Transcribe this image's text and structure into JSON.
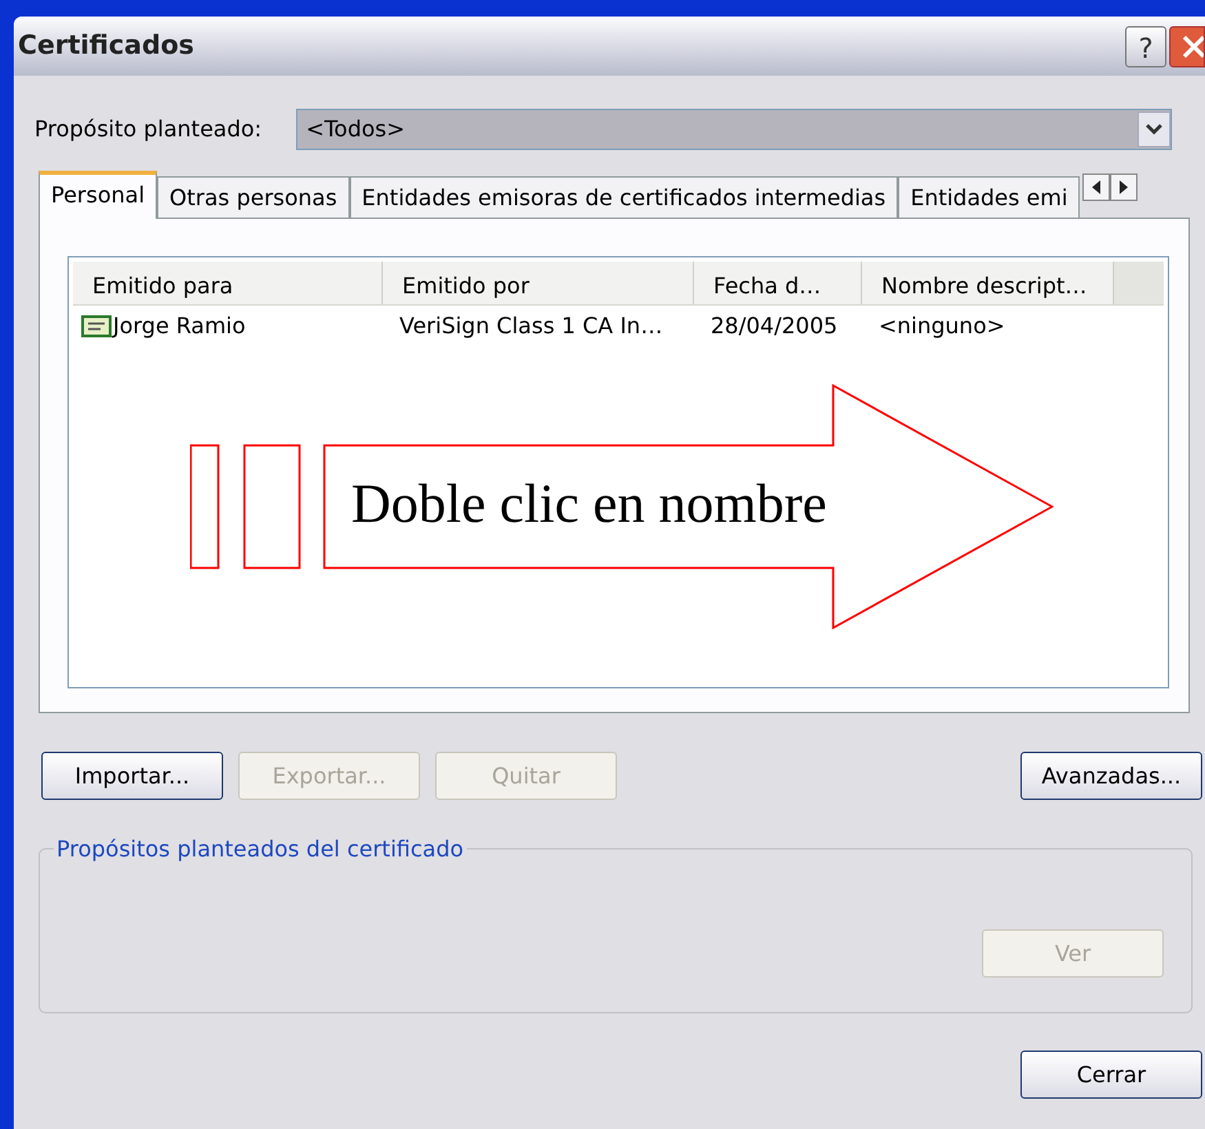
{
  "window": {
    "title": "Certificados",
    "help": "?"
  },
  "purpose": {
    "label": "Propósito planteado:",
    "value": "<Todos>"
  },
  "tabs": [
    {
      "label": "Personal",
      "selected": true
    },
    {
      "label": "Otras personas",
      "selected": false
    },
    {
      "label": "Entidades emisoras de certificados intermedias",
      "selected": false
    },
    {
      "label": "Entidades emi",
      "selected": false
    }
  ],
  "table": {
    "columns": [
      "Emitido para",
      "Emitido por",
      "Fecha d…",
      "Nombre descript…"
    ],
    "rows": [
      {
        "cells": [
          "Jorge Ramio",
          "VeriSign Class 1 CA In…",
          "28/04/2005",
          "<ninguno>"
        ],
        "selected": false
      }
    ]
  },
  "annotation": {
    "text": "Doble clic en nombre"
  },
  "buttons": [
    {
      "label": "Importar...",
      "disabled": false
    },
    {
      "label": "Exportar...",
      "disabled": true
    },
    {
      "label": "Quitar",
      "disabled": true
    }
  ],
  "advanced_button": {
    "label": "Avanzadas...",
    "disabled": false
  },
  "group": {
    "legend": "Propósitos planteados del certificado",
    "button": {
      "label": "Ver",
      "disabled": true
    }
  },
  "close_button": {
    "label": "Cerrar",
    "disabled": false
  }
}
